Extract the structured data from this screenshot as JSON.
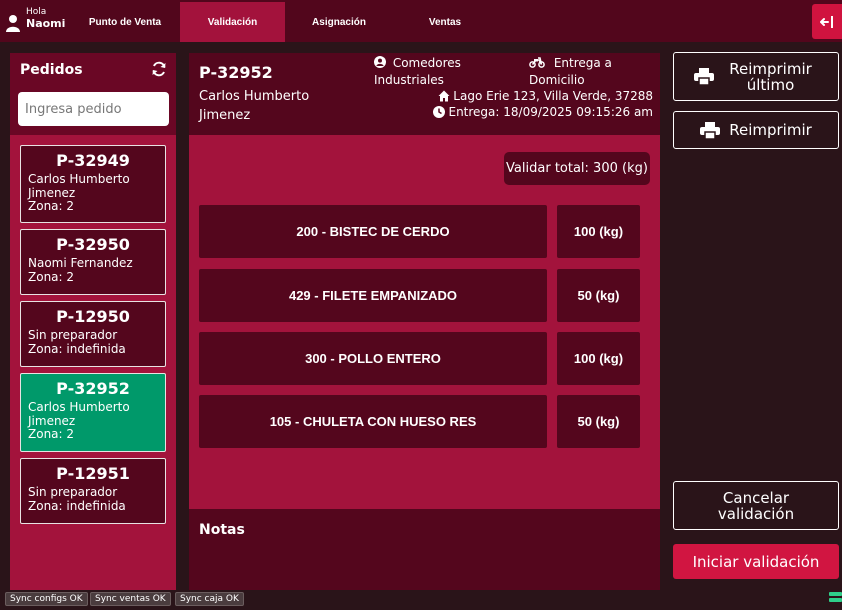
{
  "user": {
    "greeting": "Hola",
    "name": "Naomi",
    "icon": "user-icon"
  },
  "nav": {
    "tabs": [
      {
        "label": "Punto de Venta",
        "active": false
      },
      {
        "label": "Validación",
        "active": true
      },
      {
        "label": "Asignación",
        "active": false
      },
      {
        "label": "Ventas",
        "active": false
      }
    ],
    "logout_icon": "logout-icon"
  },
  "orders_panel": {
    "title": "Pedidos",
    "search_placeholder": "Ingresa pedido",
    "orders": [
      {
        "id": "P-32949",
        "lines": [
          "Carlos Humberto",
          "Jimenez",
          "Zona: 2"
        ],
        "selected": false
      },
      {
        "id": "P-32950",
        "lines": [
          "Naomi Fernandez",
          "Zona: 2"
        ],
        "selected": false
      },
      {
        "id": "P-12950",
        "lines": [
          "Sin preparador",
          "Zona: indefinida"
        ],
        "selected": false
      },
      {
        "id": "P-32952",
        "lines": [
          "Carlos Humberto",
          "Jimenez",
          "Zona: 2"
        ],
        "selected": true
      },
      {
        "id": "P-12951",
        "lines": [
          "Sin preparador",
          "Zona: indefinida"
        ],
        "selected": false
      }
    ]
  },
  "detail": {
    "order_id": "P-32952",
    "customer": "Carlos Humberto Jimenez",
    "segment": "Comedores Industriales",
    "delivery_type": "Entrega a Domicilio",
    "address": "Lago Erie 123, Villa Verde, 37288",
    "delivery_time": "Entrega: 18/09/2025 09:15:26 am",
    "total": "Validar total: 300 (kg)",
    "products": [
      {
        "name": "200 - BISTEC DE CERDO",
        "qty": "100 (kg)"
      },
      {
        "name": "429 - FILETE EMPANIZADO",
        "qty": "50 (kg)"
      },
      {
        "name": "300 - POLLO ENTERO",
        "qty": "100 (kg)"
      },
      {
        "name": "105 - CHULETA CON HUESO RES",
        "qty": "50 (kg)"
      }
    ],
    "notes_label": "Notas"
  },
  "actions": {
    "reprint_last": "Reimprimir último",
    "reprint": "Reimprimir",
    "cancel": "Cancelar validación",
    "start": "Iniciar validación"
  },
  "footer": {
    "sync": [
      "Sync configs OK",
      "Sync ventas OK",
      "Sync caja OK"
    ]
  },
  "colors": {
    "topbar": "#52061c",
    "panel_dark": "#54061d",
    "panel_accent": "#a3133c",
    "selected": "#00996a",
    "primary_button": "#d11541"
  }
}
